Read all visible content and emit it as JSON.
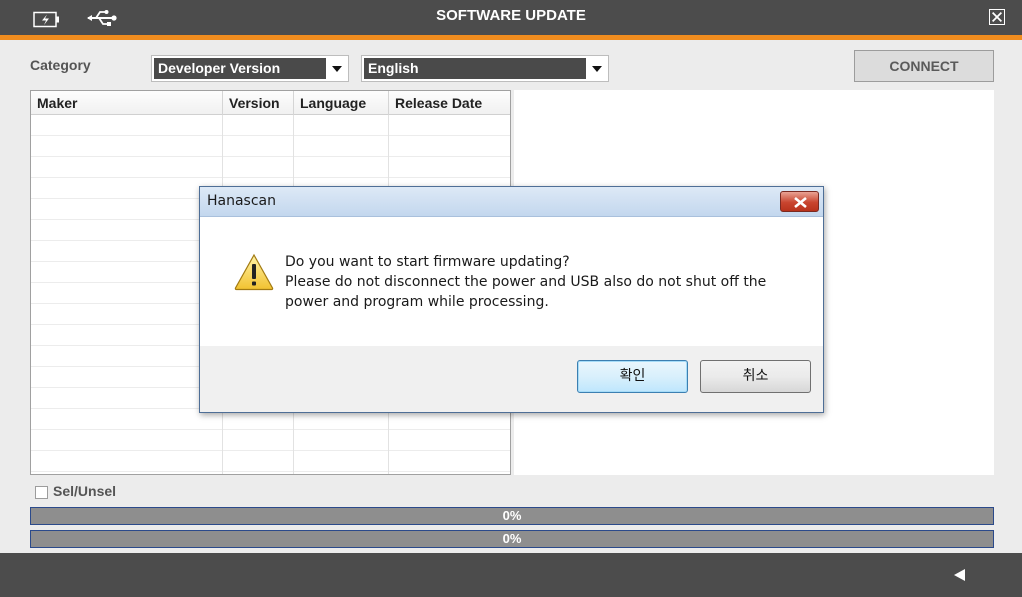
{
  "window": {
    "title": "SOFTWARE UPDATE",
    "status_icons": [
      "battery-icon",
      "usb-icon"
    ],
    "close_icon": "close-icon"
  },
  "filter": {
    "category_label": "Category",
    "category_value": "Developer Version",
    "language_value": "English",
    "connect_label": "CONNECT"
  },
  "table": {
    "columns": [
      "Maker",
      "Version",
      "Language",
      "Release Date"
    ],
    "rows": []
  },
  "selection": {
    "label": "Sel/Unsel",
    "checked": false
  },
  "progress": [
    {
      "value": 0,
      "label": "0%"
    },
    {
      "value": 0,
      "label": "0%"
    }
  ],
  "footer": {
    "back_icon": "back-arrow-icon"
  },
  "dialog": {
    "title": "Hanascan",
    "icon": "warning-icon",
    "message_lines": [
      "Do you want to start firmware updating?",
      "Please do not disconnect the power and USB also do not shut off the",
      "power and program while processing."
    ],
    "ok_label": "확인",
    "cancel_label": "취소"
  },
  "colors": {
    "titlebar": "#4c4c4c",
    "accent": "#f08c1e",
    "progress_border": "#2b4a8b",
    "progress_track": "#8e8e8e"
  }
}
